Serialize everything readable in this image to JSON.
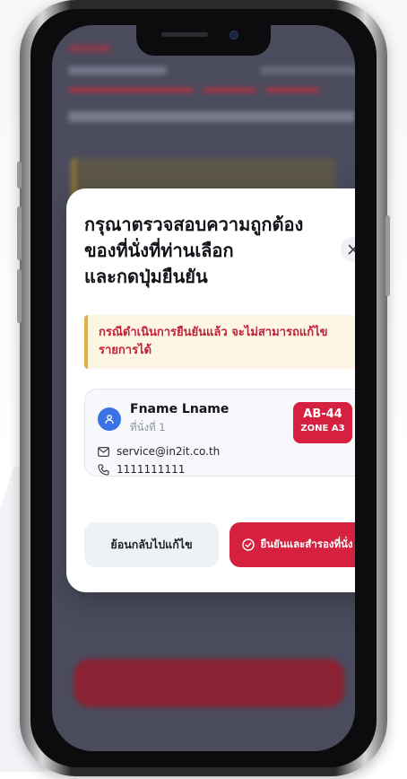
{
  "modal": {
    "title": "กรุณาตรวจสอบความถูกต้องของที่นั่งที่ท่านเลือกและกดปุ่มยืนยัน",
    "title_lines": [
      "กรุณาตรวจสอบความถูกต้อง",
      "ของที่นั่งที่ท่านเลือก",
      "และกดปุ่มยืนยัน"
    ],
    "close_icon": "close-icon",
    "warning": "กรณีดำเนินการยืนยันแล้ว จะไม่สามารถแก้ไขรายการได้",
    "warning_lines": [
      "กรณีดำเนินการยืนยันแล้ว จะไม่สามารถแก้ไข",
      "รายการได้"
    ]
  },
  "card": {
    "name": "Fname Lname",
    "seat_label": "ที่นั่งที่ 1",
    "seat_code": "AB-44",
    "zone": "ZONE A3",
    "email": "service@in2it.co.th",
    "phone": "1111111111"
  },
  "actions": {
    "back_label": "ย้อนกลับไปแก้ไข",
    "confirm_label": "ยืนยันและสำรองที่นั่ง"
  },
  "colors": {
    "accent": "#d5203f",
    "avatar": "#3b73e6",
    "warning_border": "#e2b13c",
    "warning_bg": "#fdf6e4"
  }
}
